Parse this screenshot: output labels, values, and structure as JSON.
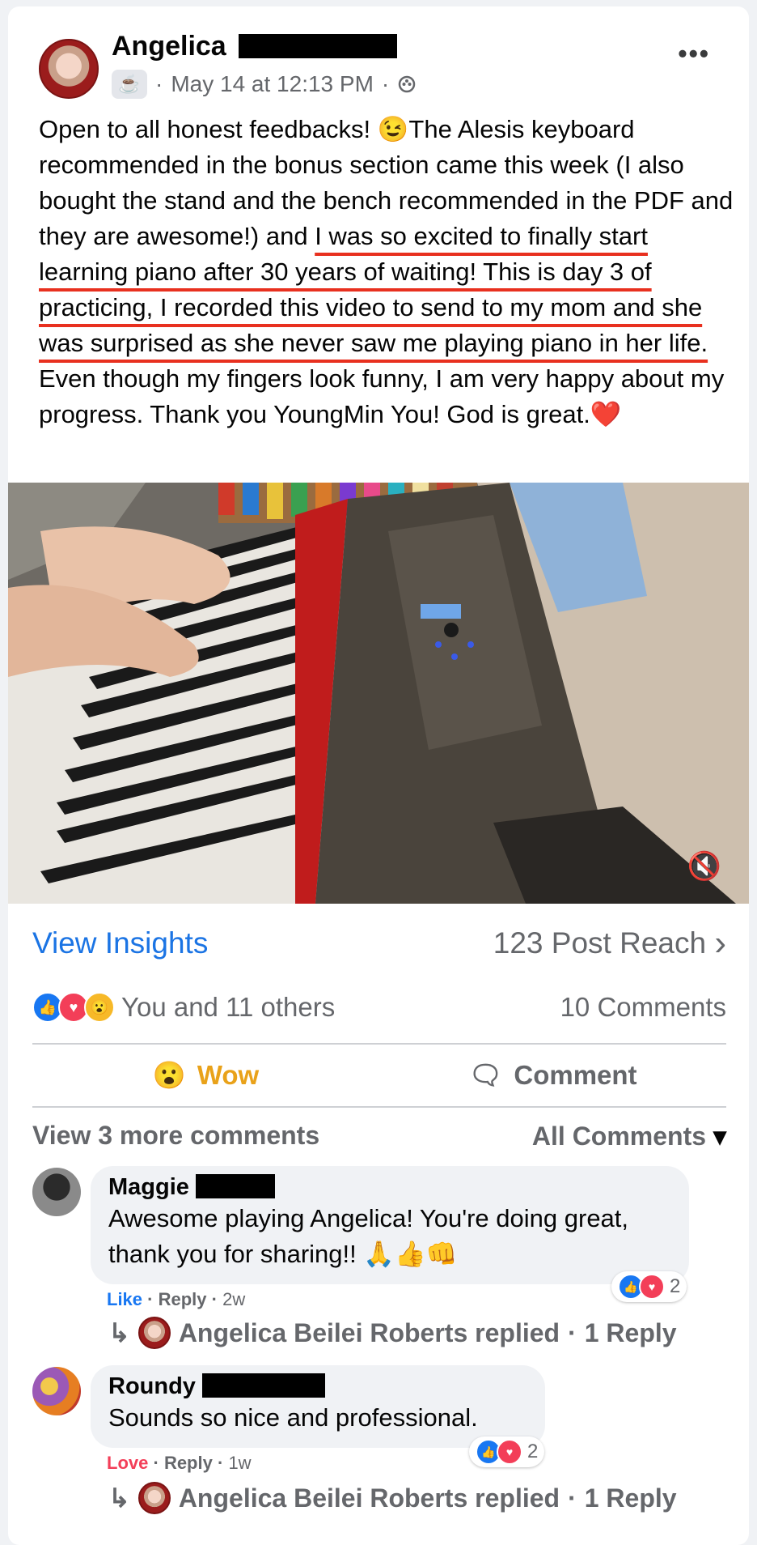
{
  "post": {
    "author_first": "Angelica",
    "meta_date": "May 14 at 12:13 PM",
    "cup_icon": "☕",
    "sep": "·",
    "more_icon": "•••",
    "text_intro": "Open to all honest feedbacks! ",
    "emoji_wink": "😉",
    "text_part1": "The Alesis keyboard recommended in the bonus section came this week (I also bought the stand and the bench recommended in the PDF and they are awesome!) and ",
    "text_highlight": "I was so excited to finally start learning piano after 30 years of waiting! This is day 3 of practicing, I recorded this video to send to my mom and she was surprised as she never saw me playing piano in her life.",
    "text_part2": " Even though my fingers look funny, I am very happy about my progress. Thank you YoungMin You! God is great.",
    "emoji_heart": "❤️"
  },
  "video": {
    "mute_icon": "🔇"
  },
  "insights": {
    "label": "View Insights",
    "reach": "123 Post Reach",
    "chevron": "›"
  },
  "reactions": {
    "summary": "You and 11 others",
    "comments_count": "10 Comments",
    "like_glyph": "👍",
    "love_glyph": "♥",
    "wow_glyph": "😮"
  },
  "actions": {
    "wow_emoji": "😮",
    "wow_label": "Wow",
    "comment_icon": "🗨",
    "comment_label": "Comment"
  },
  "comments_header": {
    "view_more": "View 3 more comments",
    "filter": "All Comments",
    "filter_icon": "▾"
  },
  "comments": [
    {
      "name": "Maggie",
      "text": "Awesome playing Angelica! You're doing great, thank you for sharing!! 🙏👍👊",
      "reaction_label": "Like",
      "reply": "Reply",
      "time": "2w",
      "react_count": "2",
      "replied_by": "Angelica Beilei Roberts replied",
      "reply_count": "1 Reply"
    },
    {
      "name": "Roundy",
      "text": "Sounds so nice and professional.",
      "reaction_label": "Love",
      "reply": "Reply",
      "time": "1w",
      "react_count": "2",
      "replied_by": "Angelica Beilei Roberts replied",
      "reply_count": "1 Reply"
    }
  ],
  "reply_arrow": "↳",
  "colors": {
    "accent": "#1b74e4",
    "highlight_underline": "#e8301f",
    "wow": "#e9a21a",
    "love": "#f33e58"
  }
}
